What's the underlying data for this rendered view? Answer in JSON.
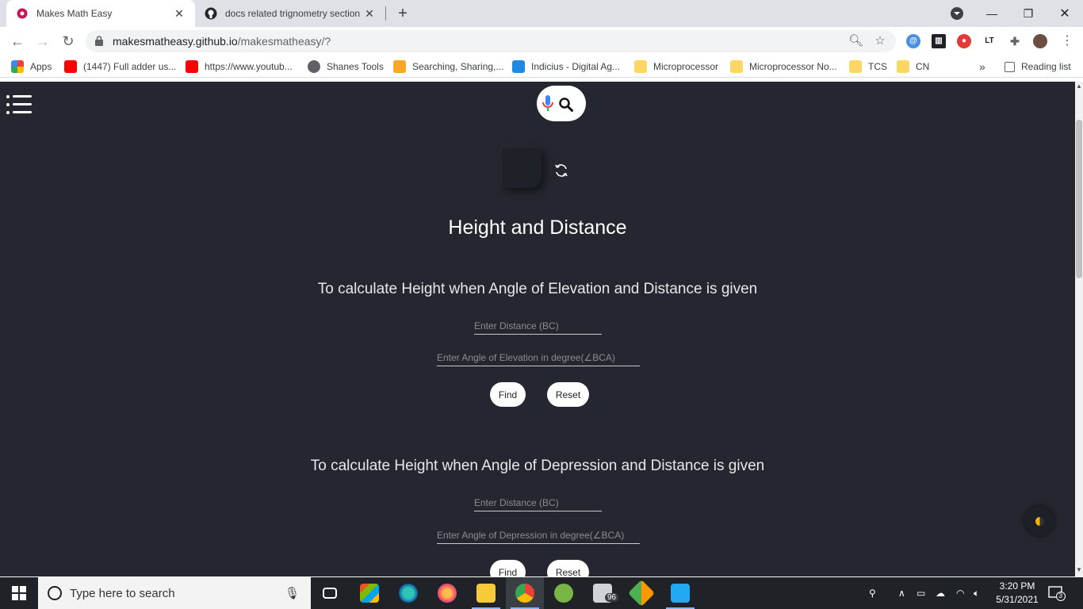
{
  "browser": {
    "tabs": [
      {
        "title": "Makes Math Easy",
        "active": true
      },
      {
        "title": "docs related trignometry section",
        "active": false
      }
    ],
    "url_host": "makesmatheasy.github.io",
    "url_path": "/makesmatheasy/?",
    "bookmarks": [
      {
        "label": "Apps",
        "icon": "apps-grid-icon"
      },
      {
        "label": "(1447) Full adder us...",
        "icon": "youtube-icon"
      },
      {
        "label": "https://www.youtub...",
        "icon": "youtube-icon"
      },
      {
        "label": "Shanes Tools",
        "icon": "globe-icon"
      },
      {
        "label": "Searching, Sharing,...",
        "icon": "puzzle-icon"
      },
      {
        "label": "Indicius - Digital Ag...",
        "icon": "indicius-icon"
      },
      {
        "label": "Microprocessor",
        "icon": "folder-icon"
      },
      {
        "label": "Microprocessor No...",
        "icon": "folder-icon"
      },
      {
        "label": "TCS",
        "icon": "folder-icon"
      },
      {
        "label": "CN",
        "icon": "folder-icon"
      }
    ],
    "more_bookmarks": "»",
    "reading_list": "Reading list"
  },
  "page": {
    "heading": "Height and Distance",
    "sections": [
      {
        "title": "To calculate Height when Angle of Elevation and Distance is given",
        "distance_placeholder": "Enter Distance (BC)",
        "angle_placeholder": "Enter Angle of Elevation in degree(∠BCA)",
        "find_label": "Find",
        "reset_label": "Reset"
      },
      {
        "title": "To calculate Height when Angle of Depression and Distance is given",
        "distance_placeholder": "Enter Distance (BC)",
        "angle_placeholder": "Enter Angle of Depression in degree(∠BCA)",
        "find_label": "Find",
        "reset_label": "Reset"
      }
    ]
  },
  "taskbar": {
    "search_placeholder": "Type here to search",
    "mail_badge": "96",
    "time": "3:20 PM",
    "date": "5/31/2021",
    "notification_count": "3"
  },
  "colors": {
    "page_bg": "#24272f",
    "text": "#ffffff"
  }
}
